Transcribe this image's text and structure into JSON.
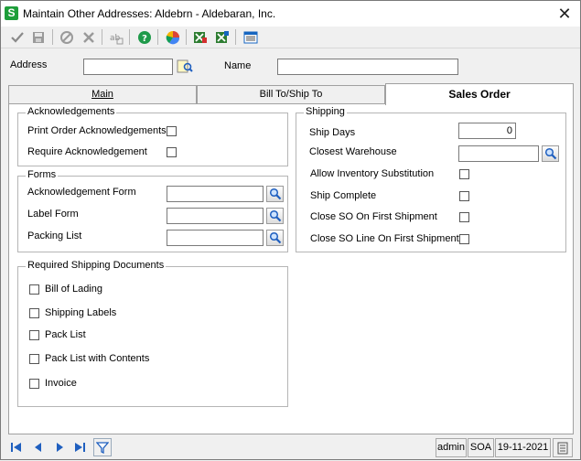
{
  "window": {
    "title": "Maintain Other Addresses: Aldebrn - Aldebaran, Inc.",
    "app_icon_letter": "S"
  },
  "header": {
    "address_label": "Address",
    "address_value": "",
    "name_label": "Name",
    "name_value": ""
  },
  "tabs": {
    "main": "Main",
    "billto": "Bill To/Ship To",
    "salesorder": "Sales Order"
  },
  "acknowledgements": {
    "title": "Acknowledgements",
    "print_label": "Print Order Acknowledgements",
    "require_label": "Require Acknowledgement"
  },
  "forms": {
    "title": "Forms",
    "ack_form_label": "Acknowledgement Form",
    "ack_form_value": "",
    "label_form_label": "Label Form",
    "label_form_value": "",
    "packing_list_label": "Packing List",
    "packing_list_value": ""
  },
  "shipping_docs": {
    "title": "Required Shipping Documents",
    "bill_of_lading": "Bill of Lading",
    "shipping_labels": "Shipping Labels",
    "pack_list": "Pack List",
    "pack_list_contents": "Pack List with Contents",
    "invoice": "Invoice"
  },
  "shipping": {
    "title": "Shipping",
    "ship_days_label": "Ship Days",
    "ship_days_value": "0",
    "closest_warehouse_label": "Closest Warehouse",
    "closest_warehouse_value": "",
    "allow_inv_sub_label": "Allow Inventory Substitution",
    "ship_complete_label": "Ship Complete",
    "close_so_label": "Close SO On First Shipment",
    "close_so_line_label": "Close SO Line On First Shipment"
  },
  "status": {
    "user": "admin",
    "company": "SOA",
    "date": "19-11-2021"
  },
  "colors": {
    "accent_green": "#1e9e3a",
    "nav_blue": "#1f5fbf",
    "help_green": "#1f9a4a"
  }
}
